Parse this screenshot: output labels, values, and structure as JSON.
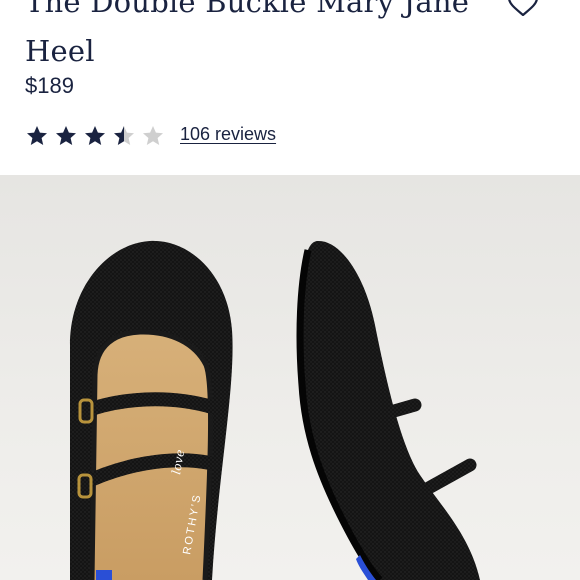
{
  "product": {
    "title": "The Double Buckle Mary Jane Heel",
    "price": "$189",
    "rating": 3.5,
    "rating_max": 5,
    "reviews_label": "106 reviews"
  },
  "image": {
    "insole_text": "ROTHY'S",
    "insole_script": "love"
  },
  "colors": {
    "text": "#1a2340",
    "star_filled": "#1a2340",
    "star_empty": "#cfcfcf",
    "photo_bg": "#e9e8e5"
  },
  "icons": {
    "wishlist": "heart-icon",
    "rating": "star-icon"
  }
}
